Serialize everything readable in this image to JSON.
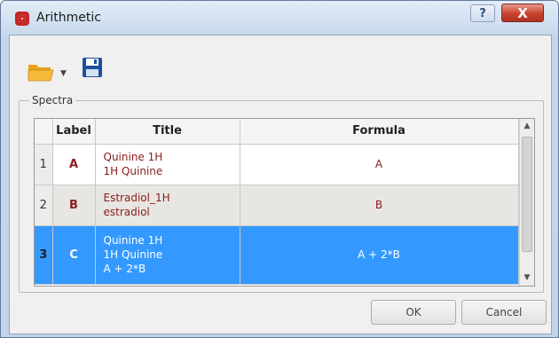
{
  "window": {
    "title": "Arithmetic",
    "help_label": "?",
    "close_label": "X"
  },
  "toolbar": {
    "open_icon": "folder-open-icon",
    "dropdown_icon": "chevron-down-icon",
    "save_icon": "save-icon"
  },
  "spectra": {
    "group_label": "Spectra",
    "columns": [
      "Label",
      "Title",
      "Formula"
    ],
    "rows": [
      {
        "num": "1",
        "label": "A",
        "title_line1": "Quinine 1H",
        "title_line2": "1H Quinine",
        "title_line3": "",
        "formula": "A"
      },
      {
        "num": "2",
        "label": "B",
        "title_line1": "Estradiol_1H",
        "title_line2": "estradiol",
        "title_line3": "",
        "formula": "B"
      },
      {
        "num": "3",
        "label": "C",
        "title_line1": "Quinine 1H",
        "title_line2": "1H Quinine",
        "title_line3": "A + 2*B",
        "formula": "A + 2*B"
      }
    ],
    "selected_row": 3
  },
  "buttons": {
    "ok": "OK",
    "cancel": "Cancel"
  },
  "colors": {
    "selection": "#3399ff",
    "label_text": "#8a1d1d",
    "close_button": "#c8422d"
  }
}
